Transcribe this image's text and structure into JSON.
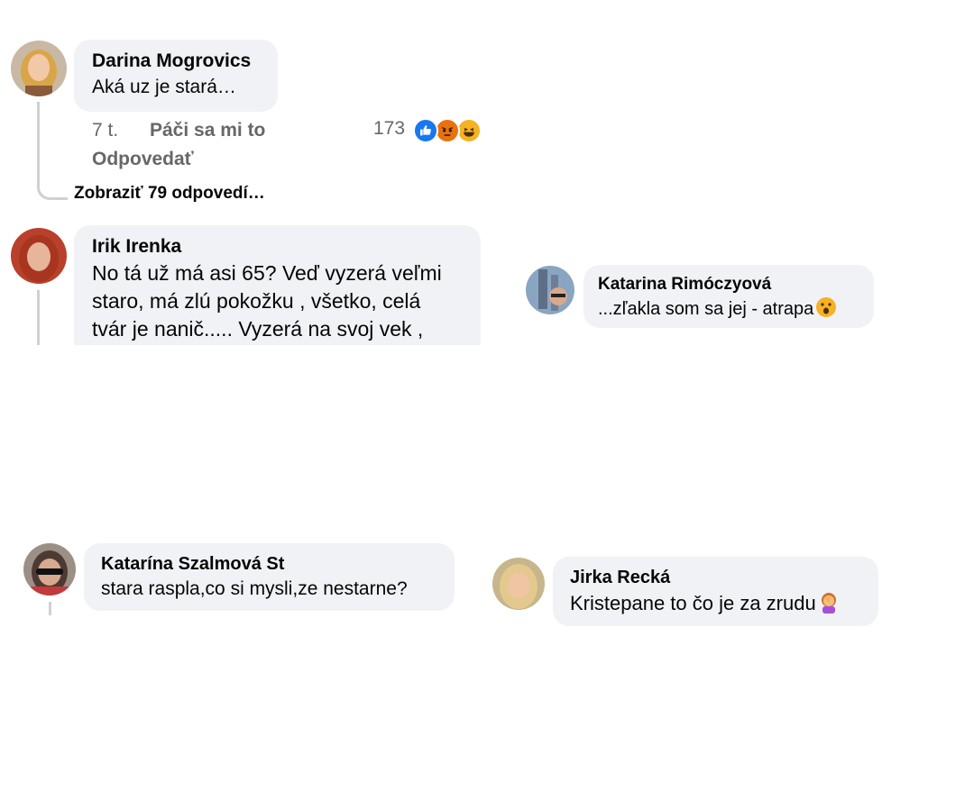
{
  "comments": [
    {
      "author": "Darina Mogrovics",
      "text": "Aká uz je stará…",
      "time": "7 t.",
      "like_label": "Páči sa mi to",
      "reply_label": "Odpovedať",
      "reaction_count": "173",
      "reactions": [
        "like-icon",
        "angry-icon",
        "haha-icon"
      ],
      "show_replies_label": "Zobraziť 79 odpovedí…"
    },
    {
      "author": "Irik Irenka",
      "lines": [
        "No tá už má asi 65? Veď vyzerá veľmi",
        "staro, má zlú pokožku , všetko, celá",
        "tvár je nanič..... Vyzerá na svoj vek ,"
      ]
    },
    {
      "author": "Katarina Rimóczyová",
      "text": "...zľakla som sa jej - atrapa",
      "emoji": "astonished-face-icon"
    },
    {
      "author": "Katarína Szalmová St",
      "text": "stara raspla,co si mysli,ze nestarne?"
    },
    {
      "author": "Jirka Recká",
      "text": "Kristepane to čo je za zrudu",
      "emoji": "facepalm-woman-icon"
    }
  ],
  "colors": {
    "bubble": "#f0f2f5",
    "text": "#050505",
    "meta": "#65676b",
    "thread_line": "#ced0d4",
    "like_blue": "#1877f2",
    "angry": "#e9710f",
    "haha": "#f7b125"
  }
}
